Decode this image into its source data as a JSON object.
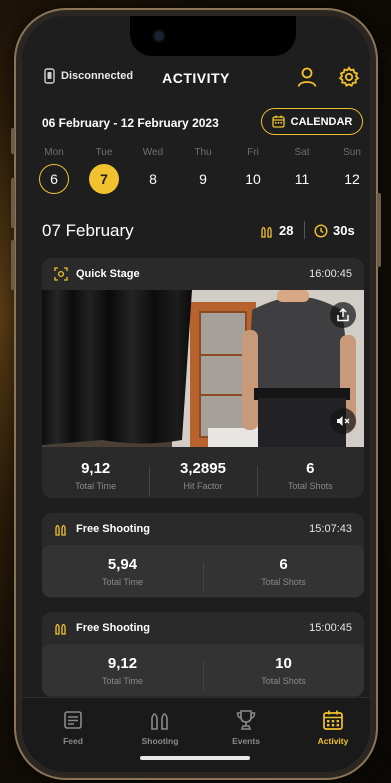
{
  "header": {
    "connection_status": "Disconnected",
    "title": "ACTIVITY",
    "profile_icon": "user-icon",
    "settings_icon": "gear-icon"
  },
  "date_range": "06 February - 12 February 2023",
  "calendar_button": "CALENDAR",
  "week": [
    {
      "name": "Mon",
      "num": "6"
    },
    {
      "name": "Tue",
      "num": "7"
    },
    {
      "name": "Wed",
      "num": "8"
    },
    {
      "name": "Thu",
      "num": "9"
    },
    {
      "name": "Fri",
      "num": "10"
    },
    {
      "name": "Sat",
      "num": "11"
    },
    {
      "name": "Sun",
      "num": "12"
    }
  ],
  "selected_date": "07 February",
  "day_summary": {
    "shots": "28",
    "time": "30s"
  },
  "sessions": [
    {
      "title": "Quick Stage",
      "time": "16:00:45",
      "stats": [
        {
          "value": "9,12",
          "label": "Total Time"
        },
        {
          "value": "3,2895",
          "label": "Hit Factor"
        },
        {
          "value": "6",
          "label": "Total Shots"
        }
      ]
    },
    {
      "title": "Free Shooting",
      "time": "15:07:43",
      "stats": [
        {
          "value": "5,94",
          "label": "Total Time"
        },
        {
          "value": "6",
          "label": "Total Shots"
        }
      ]
    },
    {
      "title": "Free Shooting",
      "time": "15:00:45",
      "stats": [
        {
          "value": "9,12",
          "label": "Total Time"
        },
        {
          "value": "10",
          "label": "Total Shots"
        }
      ]
    }
  ],
  "tabs": [
    {
      "label": "Feed",
      "icon": "feed-icon"
    },
    {
      "label": "Shooting",
      "icon": "bullets-icon"
    },
    {
      "label": "Events",
      "icon": "trophy-icon"
    },
    {
      "label": "Activity",
      "icon": "calendar-icon"
    }
  ],
  "colors": {
    "accent": "#f2c12e",
    "background": "#1e1e1e",
    "card": "#2a2a2a"
  }
}
